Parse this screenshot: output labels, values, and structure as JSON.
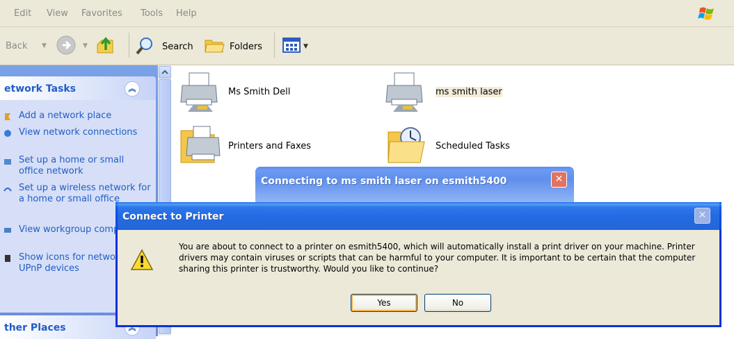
{
  "menu": [
    "Edit",
    "View",
    "Favorites",
    "Tools",
    "Help"
  ],
  "toolbar": {
    "back": "Back",
    "search": "Search",
    "folders": "Folders"
  },
  "task_pane": {
    "network_tasks": {
      "title": "etwork Tasks",
      "items": [
        "Add a network place",
        "View network connections",
        "Set up a home or small office network",
        "Set up a wireless network for a home or small office",
        "View workgroup computers",
        "Show icons for networked UPnP devices"
      ]
    },
    "other_places": {
      "title": "ther Places"
    }
  },
  "content": {
    "items": [
      {
        "label": "Ms Smith Dell",
        "icon": "printer-icon"
      },
      {
        "label": "ms smith laser",
        "icon": "printer-icon"
      },
      {
        "label": "Printers and Faxes",
        "icon": "printers-folder-icon"
      },
      {
        "label": "Scheduled Tasks",
        "icon": "scheduled-tasks-icon"
      }
    ]
  },
  "connecting_dialog": {
    "title": "Connecting to ms smith laser on esmith5400"
  },
  "connect_dialog": {
    "title": "Connect to Printer",
    "message": "You are about to connect to a printer on esmith5400, which will automatically install a print driver on your machine. Printer drivers may contain viruses or scripts that can be harmful to your computer.  It is important to be certain that the computer sharing this printer is trustworthy.  Would you like to continue?",
    "yes": "Yes",
    "no": "No"
  },
  "colors": {
    "xp_blue": "#0055e5",
    "task_link": "#215dc6",
    "chrome": "#ece9d8"
  }
}
